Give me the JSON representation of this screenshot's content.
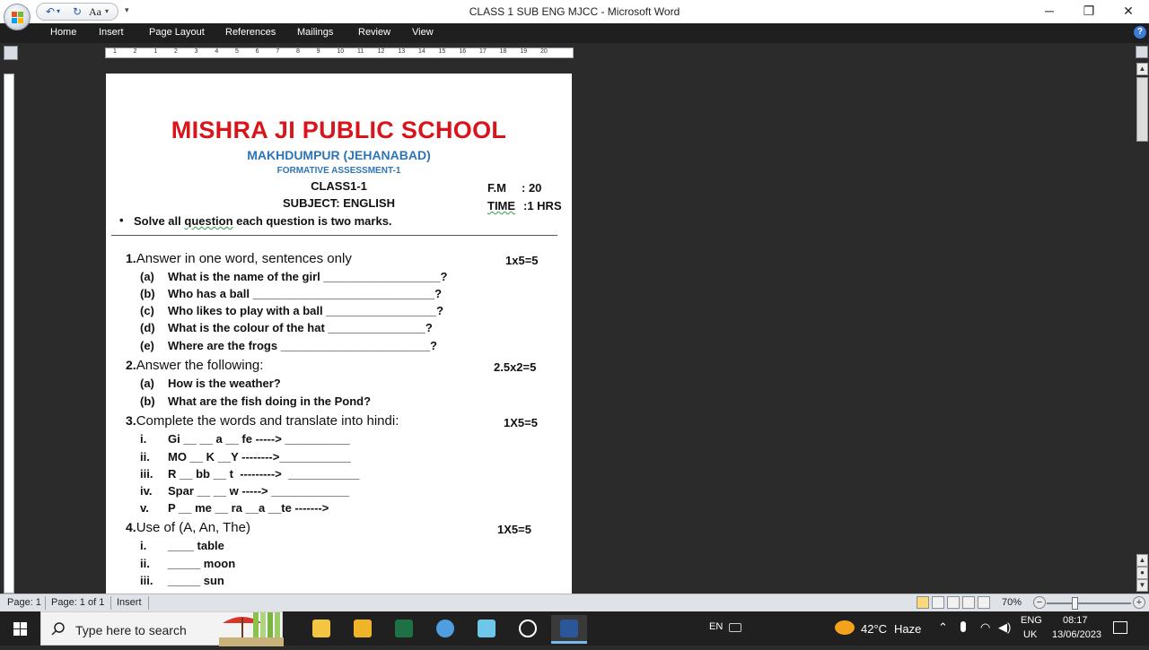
{
  "window": {
    "title": "CLASS 1 SUB ENG MJCC - Microsoft Word",
    "controls": {
      "minimize": "─",
      "restore": "❐",
      "close": "✕"
    },
    "quick_access": {
      "undo": "↶",
      "redo": "↻",
      "font": "Aa",
      "more": "▾"
    }
  },
  "ribbon": {
    "tabs": [
      "Home",
      "Insert",
      "Page Layout",
      "References",
      "Mailings",
      "Review",
      "View"
    ],
    "help": "?"
  },
  "ruler": {
    "numbers": [
      "1",
      "2",
      "1",
      "2",
      "3",
      "4",
      "5",
      "6",
      "7",
      "8",
      "9",
      "10",
      "11",
      "12",
      "13",
      "14",
      "15",
      "16",
      "17",
      "18",
      "19",
      "20"
    ]
  },
  "document": {
    "school_name": "MISHRA JI PUBLIC SCHOOL",
    "place": "MAKHDUMPUR (JEHANABAD)",
    "assessment": "FORMATIVE ASSESSMENT-1",
    "class": "CLASS1-1",
    "subject": "SUBJECT: ENGLISH",
    "fm_label": "F.M",
    "fm_value": ": 20",
    "time_label": "TIME",
    "time_value": ":1 HRS",
    "instruction_bullet": "•",
    "instruction_pre": "Solve all ",
    "instruction_squig": "question",
    "instruction_post": " each question is two marks.",
    "questions": [
      {
        "num": "1.",
        "title": "Answer in one word, sentences only",
        "marks": "1x5=5",
        "items": [
          {
            "label": "(a)",
            "text": "What is the name of the girl __________________?"
          },
          {
            "label": "(b)",
            "text": "Who has a ball ____________________________?"
          },
          {
            "label": "(c)",
            "text": "Who likes to play with a ball _________________?"
          },
          {
            "label": "(d)",
            "text": "What is the colour of the hat _______________?"
          },
          {
            "label": "(e)",
            "text": "Where are the frogs _______________________?"
          }
        ]
      },
      {
        "num": "2.",
        "title": "Answer the following:",
        "marks": "2.5x2=5",
        "items": [
          {
            "label": "(a)",
            "text": "How is the weather?"
          },
          {
            "label": "(b)",
            "text": "What are the fish doing in the Pond?"
          }
        ]
      },
      {
        "num": "3.",
        "title": "Complete the words and translate into hindi:",
        "marks": "1X5=5",
        "items": [
          {
            "label": "i.",
            "text": "Gi __ __ a __ fe -----> __________"
          },
          {
            "label": "ii.",
            "text": "MO __ K __Y -------->___________"
          },
          {
            "label": "iii.",
            "text": "R __ bb __ t  --------->  ___________"
          },
          {
            "label": "iv.",
            "text": "Spar __ __ w -----> ____________"
          },
          {
            "label": "v.",
            "text": "P __ me __ ra __a __te ------->"
          }
        ]
      },
      {
        "num": "4.",
        "title": "Use of (A, An, The)",
        "marks": "1X5=5",
        "items": [
          {
            "label": "i.",
            "text": "____ table"
          },
          {
            "label": "ii.",
            "text": "_____ moon"
          },
          {
            "label": "iii.",
            "text": "_____ sun"
          }
        ]
      }
    ]
  },
  "statusbar": {
    "page": "Page: 1",
    "page_of": "Page: 1 of 1",
    "mode": "Insert",
    "zoom": "70%",
    "zoom_minus": "−",
    "zoom_plus": "+"
  },
  "taskbar": {
    "search_placeholder": "Type here to search",
    "lang_small": "EN",
    "weather_temp": "42°C",
    "weather_desc": "Haze",
    "lang_top": "ENG",
    "lang_bottom": "UK",
    "time": "08:17",
    "date": "13/06/2023"
  },
  "colors": {
    "school_red": "#d9141b",
    "heading_blue": "#2e75b6",
    "ribbon_bg": "#1f1f1f",
    "taskbar_bg": "#202020"
  }
}
